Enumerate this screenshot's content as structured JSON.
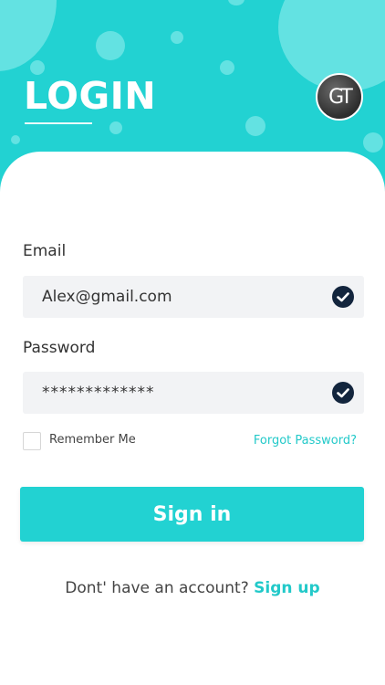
{
  "header": {
    "title": "LOGIN",
    "logo_text": "GT"
  },
  "form": {
    "email_label": "Email",
    "email_value": "Alex@gmail.com",
    "password_label": "Password",
    "password_value": "*************",
    "remember_label": "Remember Me",
    "remember_checked": false,
    "forgot_link": "Forgot Password?",
    "signin_label": "Sign in"
  },
  "footer": {
    "prompt": "Dont' have an account?",
    "signup_link": "Sign up"
  },
  "colors": {
    "accent": "#22d2d2",
    "bubble": "#63e2e2",
    "check": "#13253d",
    "input_bg": "#f2f3f5"
  }
}
